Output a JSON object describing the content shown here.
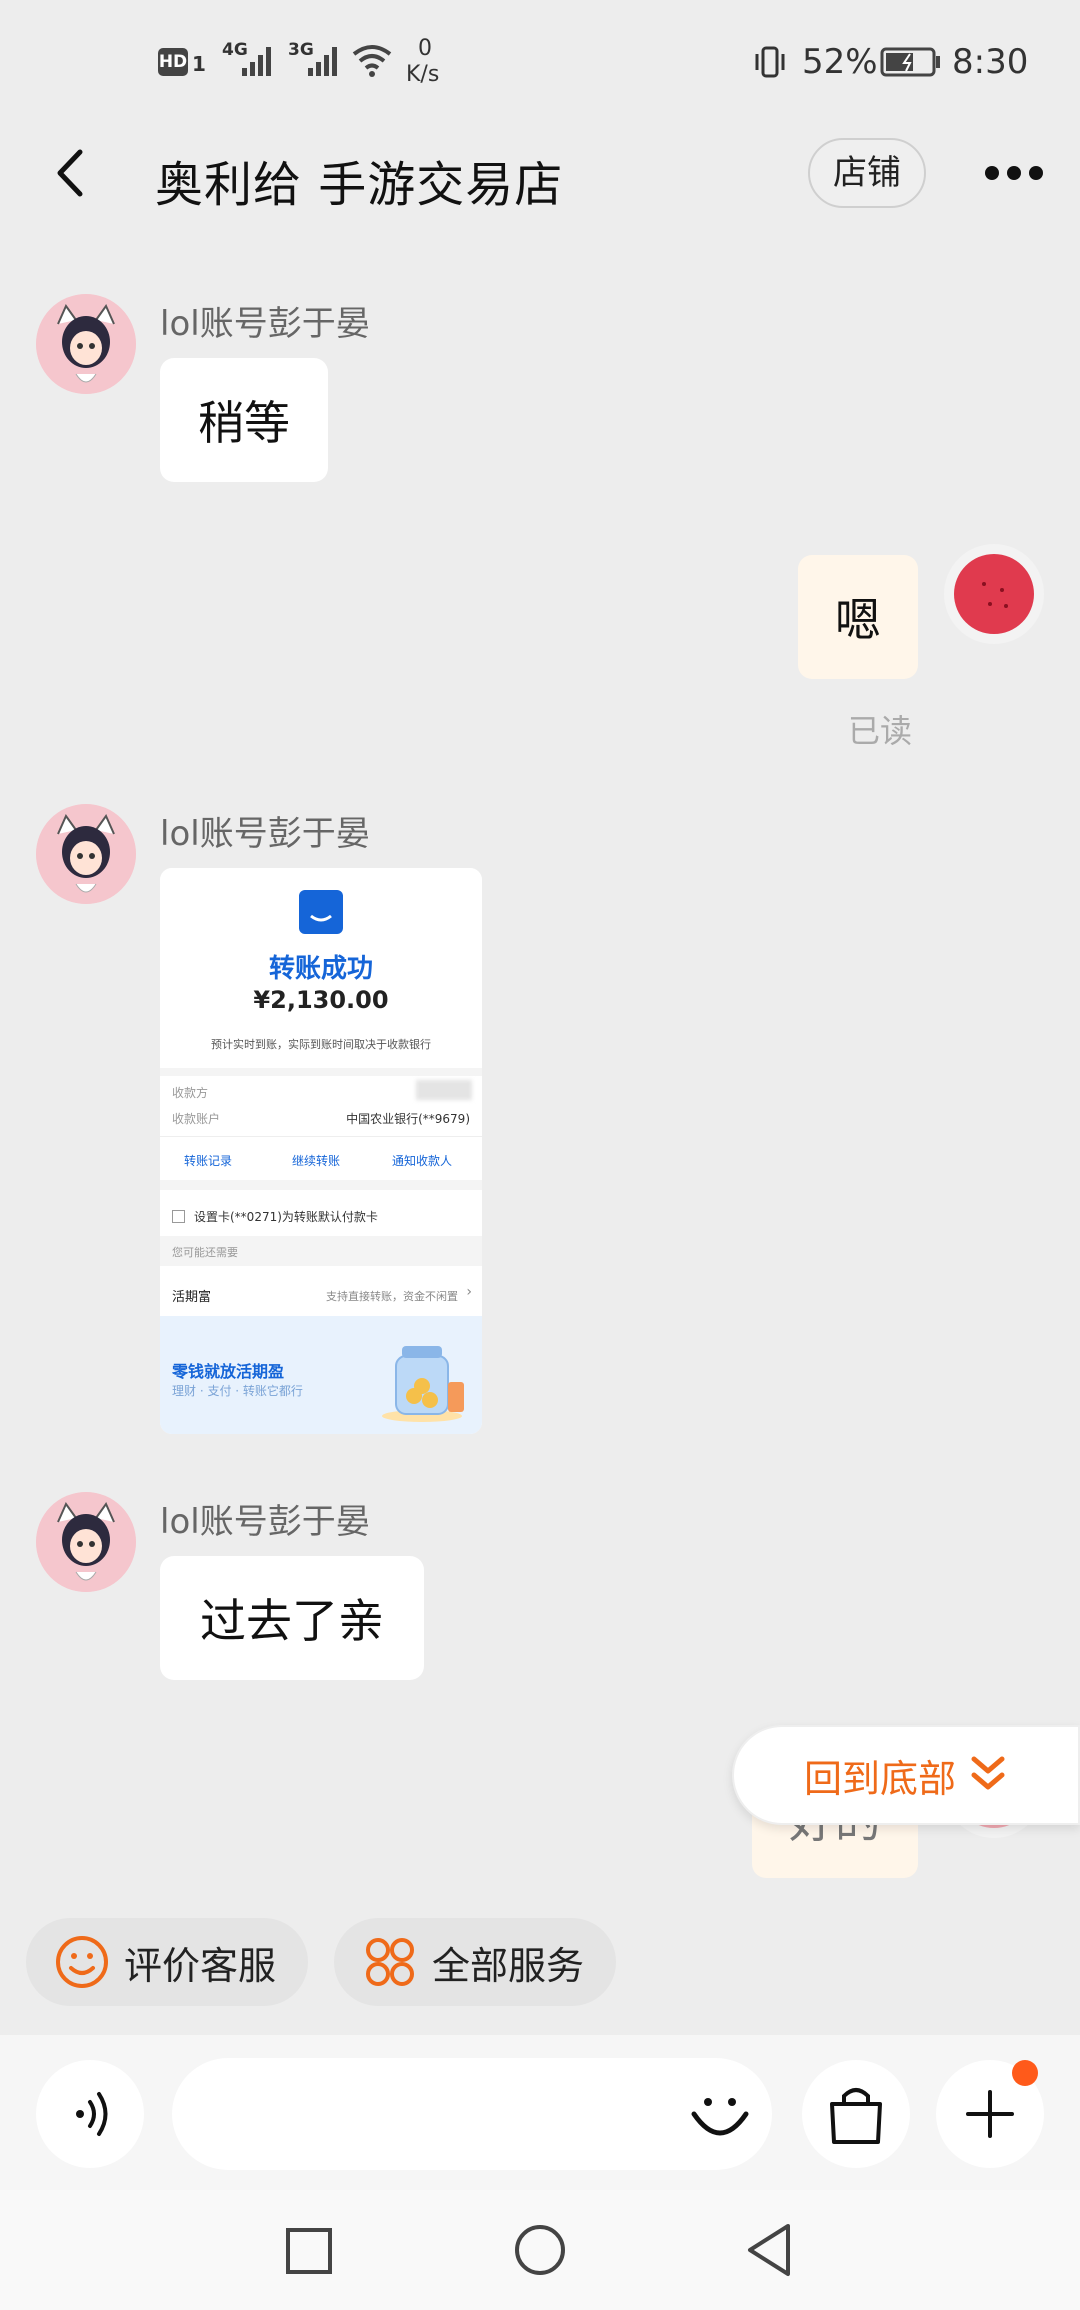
{
  "status_bar": {
    "network_hd": "HD",
    "network_hd_sim": "1",
    "signal_4g": "4G",
    "signal_3g": "3G",
    "speed_value": "0",
    "speed_unit": "K/s",
    "battery": "52%",
    "time": "8:30"
  },
  "header": {
    "title": "奥利给 手游交易店",
    "shop_button": "店铺"
  },
  "messages": [
    {
      "side": "left",
      "sender": "lol账号彭于晏",
      "text": "稍等"
    },
    {
      "side": "right",
      "text": "嗯",
      "status": "已读"
    },
    {
      "side": "left",
      "sender": "lol账号彭于晏",
      "type": "image"
    },
    {
      "side": "left",
      "sender": "lol账号彭于晏",
      "text": "过去了亲"
    },
    {
      "side": "right",
      "text": "好的"
    }
  ],
  "transfer_card": {
    "title": "转账成功",
    "amount": "¥2,130.00",
    "note": "预计实时到账，实际到账时间取决于收款银行",
    "payee_label": "收款方",
    "account_label": "收款账户",
    "account_value": "中国农业银行(**9679)",
    "actions": [
      "转账记录",
      "继续转账",
      "通知收款人"
    ],
    "default_card": "设置卡(**0271)为转账默认付款卡",
    "maybe_need": "您可能还需要",
    "product_name": "活期富",
    "product_desc": "支持直接转账，资金不闲置",
    "banner_title": "零钱就放活期盈",
    "banner_sub": "理财 · 支付 · 转账它都行"
  },
  "scroll_bottom": "回到底部",
  "quick_actions": [
    {
      "label": "评价客服",
      "icon": "smile-icon"
    },
    {
      "label": "全部服务",
      "icon": "apps-icon"
    }
  ],
  "colors": {
    "accent": "#ef6a19",
    "background": "#ededed",
    "my_bubble": "#fff6ea",
    "blue": "#1677ff"
  }
}
